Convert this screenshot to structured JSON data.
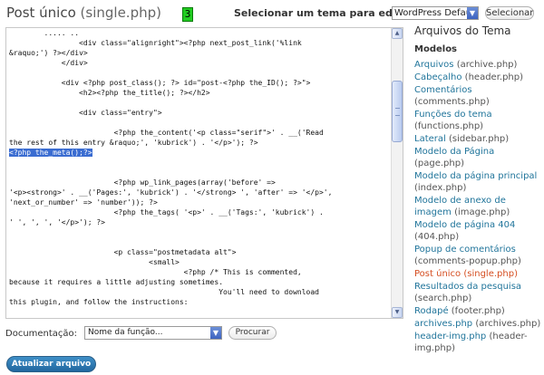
{
  "header": {
    "title": "Post único",
    "file": "(single.php)",
    "badge": "3",
    "theme_label": "Selecionar um tema para editar:",
    "theme_selected": "WordPress Default",
    "select_button": "Selecionar"
  },
  "editor": {
    "lines_before": "        ..... ..\n                <div class=\"alignright\"><?php next_post_link('%link\n&raquo;') ?></div>\n            </div>\n\n            <div <?php post_class(); ?> id=\"post-<?php the_ID(); ?>\">\n                <h2><?php the_title(); ?></h2>\n\n                <div class=\"entry\">\n\n                        <?php the_content('<p class=\"serif\">' . __('Read\nthe rest of this entry &raquo;', 'kubrick') . '</p>'); ?>\n",
    "selected": "<?php the_meta();?>",
    "lines_after": "\n\n\n                        <?php wp_link_pages(array('before' =>\n'<p><strong>' . __('Pages:', 'kubrick') . '</strong> ', 'after' => '</p>',\n'next_or_number' => 'number')); ?>\n                        <?php the_tags( '<p>' . __('Tags:', 'kubrick') .\n' ', ', ', '</p>'); ?>\n\n\n                        <p class=\"postmetadata alt\">\n                                <small>\n                                        <?php /* This is commented,\nbecause it requires a little adjusting sometimes.\n                                                You'll need to download\nthis plugin, and follow the instructions:"
  },
  "documentation": {
    "label": "Documentação:",
    "placeholder": "Nome da função...",
    "search_button": "Procurar"
  },
  "update_button": "Atualizar arquivo",
  "sidebar": {
    "title": "Arquivos do Tema",
    "subtitle": "Modelos",
    "items": [
      {
        "label": "Arquivos",
        "file": "(archive.php)"
      },
      {
        "label": "Cabeçalho",
        "file": "(header.php)"
      },
      {
        "label": "Comentários",
        "file": "(comments.php)"
      },
      {
        "label": "Funções do tema",
        "file": "(functions.php)"
      },
      {
        "label": "Lateral",
        "file": "(sidebar.php)"
      },
      {
        "label": "Modelo da Página",
        "file": "(page.php)"
      },
      {
        "label": "Modelo da página principal",
        "file": "(index.php)"
      },
      {
        "label": "Modelo de anexo de imagem",
        "file": "(image.php)"
      },
      {
        "label": "Modelo de página 404",
        "file": "(404.php)"
      },
      {
        "label": "Popup de comentários",
        "file": "(comments-popup.php)"
      },
      {
        "label": "Post único",
        "file": "(single.php)",
        "current": true
      },
      {
        "label": "Resultados da pesquisa",
        "file": "(search.php)"
      },
      {
        "label": "Rodapé",
        "file": "(footer.php)"
      },
      {
        "label": "archives.php",
        "file": "(archives.php)"
      },
      {
        "label": "header-img.php",
        "file": "(header-img.php)"
      }
    ]
  },
  "colors": {
    "link": "#21759b",
    "current": "#d54e21",
    "selection": "#3a6cd1",
    "primary_button": "#21679f",
    "badge": "#22cc22"
  }
}
